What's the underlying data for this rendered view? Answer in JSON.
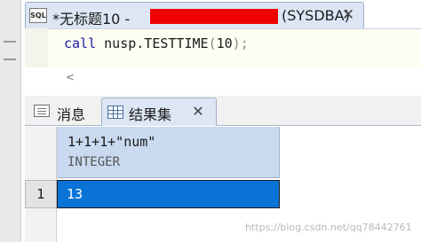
{
  "editor_tab": {
    "icon": "sql-file-icon",
    "icon_text": "SQL",
    "title_prefix": "*无标题10 -",
    "title_suffix": "(SYSDBA)",
    "close_glyph": "✕"
  },
  "editor": {
    "tokens": {
      "call": "call",
      "proc": "nusp.TESTTIME",
      "open": "(",
      "arg": "10",
      "close": ")",
      "semi": ";"
    },
    "scroll_left_glyph": "<"
  },
  "result_tabs": {
    "messages_label": "消息",
    "results_label": "结果集",
    "close_glyph": "✕"
  },
  "result_grid": {
    "columns": [
      {
        "name": "1+1+1+\"num\"",
        "type": "INTEGER"
      }
    ],
    "rows": [
      {
        "row_number": "1",
        "values": [
          "13"
        ]
      }
    ]
  },
  "watermark": "https://blog.csdn.net/qq78442761",
  "colors": {
    "tab_active": "#dce6f4",
    "column_header": "#c9daf0",
    "selected_cell": "#0a74d6",
    "redaction": "#f00000",
    "keyword": "#1c1ca8"
  }
}
